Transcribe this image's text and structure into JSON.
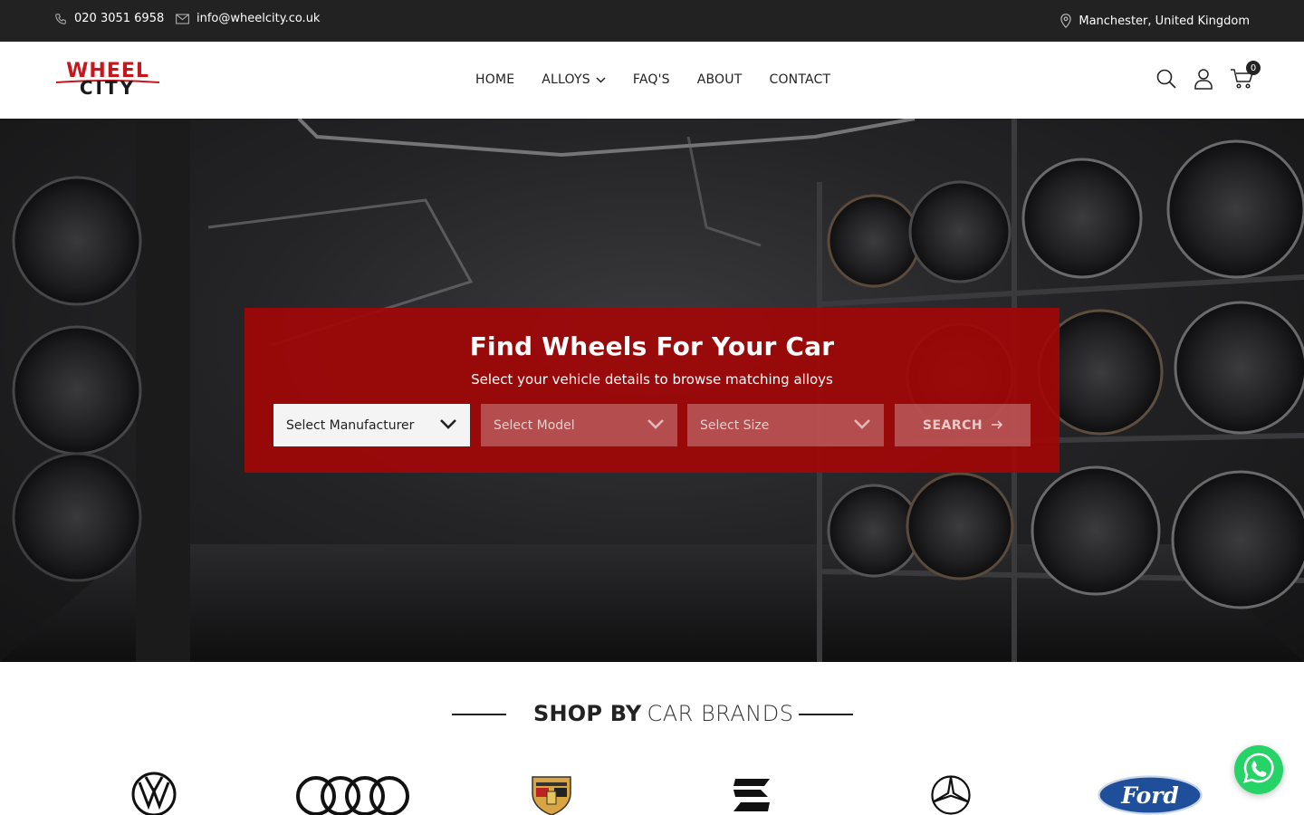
{
  "topbar": {
    "phone": "020 3051 6958",
    "email": "info@wheelcity.co.uk",
    "location": "Manchester, United Kingdom"
  },
  "logo": {
    "line1": "WHEEL",
    "line2": "CITY"
  },
  "nav": {
    "items": [
      {
        "label": "HOME"
      },
      {
        "label": "ALLOYS"
      },
      {
        "label": "FAQ'S"
      },
      {
        "label": "ABOUT"
      },
      {
        "label": "CONTACT"
      }
    ]
  },
  "header_icons": {
    "search": "search-icon",
    "account": "user-icon",
    "cart": "cart-icon",
    "cart_count": "0"
  },
  "finder": {
    "title": "Find Wheels For Your Car",
    "subtitle": "Select your vehicle details to browse matching alloys",
    "manufacturer_placeholder": "Select Manufacturer",
    "model_placeholder": "Select Model",
    "size_placeholder": "Select Size",
    "search_label": "SEARCH"
  },
  "brands": {
    "title_bold": "SHOP BY",
    "title_light": "CAR BRANDS",
    "logos": [
      "volkswagen-logo",
      "audi-logo",
      "porsche-logo",
      "seat-logo",
      "mercedes-logo",
      "ford-logo"
    ],
    "ford_text": "Ford"
  },
  "colors": {
    "topbar": "#222222",
    "accent": "#a00808",
    "brand_red": "#c8161d",
    "whatsapp": "#25d366"
  }
}
